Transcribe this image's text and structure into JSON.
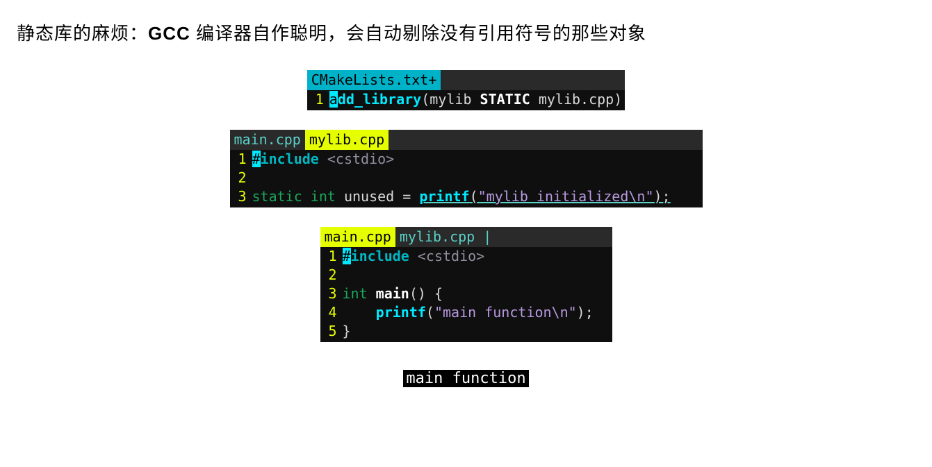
{
  "heading": {
    "pre": "静态库的麻烦：",
    "bold": "GCC",
    "post": " 编译器自作聪明，会自动剔除没有引用符号的那些对象"
  },
  "block1": {
    "tab": "CMakeLists.txt+",
    "line1": {
      "num": "1",
      "cursor": "a",
      "fn": "dd_library",
      "open": "(mylib ",
      "kw": "STATIC",
      "close": " mylib.cpp)"
    }
  },
  "block2": {
    "tab_inactive": "main.cpp ",
    "tab_active": " mylib.cpp ",
    "lines": {
      "l1": {
        "num": "1",
        "cursor": "#",
        "kw": "include",
        "sp": " ",
        "hdr": "<cstdio>"
      },
      "l2": {
        "num": "2"
      },
      "l3": {
        "num": "3",
        "kw1": "static",
        "sp1": " ",
        "kw2": "int",
        "sp2": " ",
        "name": "unused = ",
        "call": "printf",
        "open": "(",
        "str": "\"mylib initialized\\n\"",
        "close": ");"
      }
    }
  },
  "block3": {
    "tab_active": " main.cpp ",
    "tab_inactive": " mylib.cpp |",
    "lines": {
      "l1": {
        "num": "1",
        "cursor": "#",
        "kw": "include",
        "sp": " ",
        "hdr": "<cstdio>"
      },
      "l2": {
        "num": "2"
      },
      "l3": {
        "num": "3",
        "kw": "int",
        "sp": " ",
        "name": "main",
        "rest": "() {"
      },
      "l4": {
        "num": "4",
        "indent": "    ",
        "call": "printf",
        "open": "(",
        "str": "\"main function\\n\"",
        "close": ");"
      },
      "l5": {
        "num": "5",
        "brace": "}"
      }
    }
  },
  "output": "main function"
}
